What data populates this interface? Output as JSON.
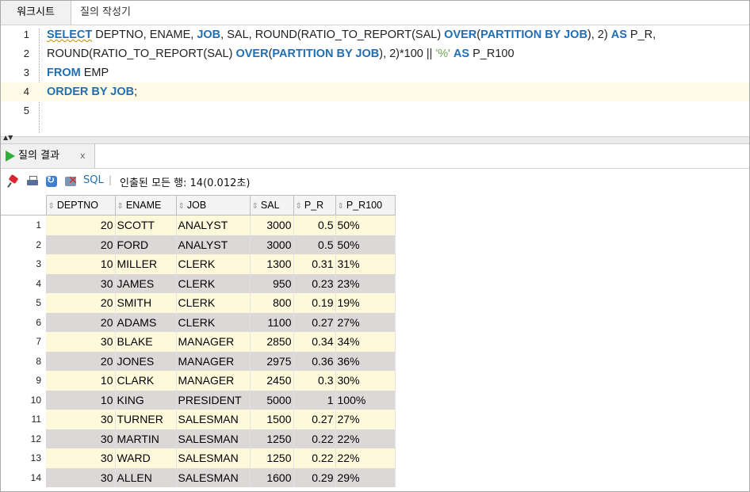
{
  "worksheet_tabs": {
    "active": "워크시트",
    "other": "질의 작성기"
  },
  "editor": {
    "lines": [
      {
        "num": "1"
      },
      {
        "num": "2"
      },
      {
        "num": "3"
      },
      {
        "num": "4"
      },
      {
        "num": "5"
      }
    ],
    "l1": {
      "a": "SELECT",
      "b": " DEPTNO, ENAME, ",
      "c": "JOB",
      "d": ", SAL, ROUND(RATIO_TO_REPORT(SAL) ",
      "e": "OVER",
      "f": "(",
      "g": "PARTITION BY JOB",
      "h": "), 2) ",
      "i": "AS",
      "j": " P_R,"
    },
    "l2": {
      "a": "ROUND(RATIO_TO_REPORT(SAL) ",
      "b": "OVER",
      "c": "(",
      "d": "PARTITION BY JOB",
      "e": "), 2)*100 || ",
      "f": "'%'",
      "g": " ",
      "h": "AS",
      "i": " P_R100"
    },
    "l3": {
      "a": "FROM",
      "b": " EMP"
    },
    "l4": {
      "a": "ORDER BY JOB",
      "b": ";"
    }
  },
  "results": {
    "tab_label": "질의 결과",
    "tab_close": "x",
    "toolbar": {
      "sql_label": "SQL",
      "separator": "|",
      "fetch_status": "인출된 모든 행: 14(0.012초)"
    },
    "columns": [
      "DEPTNO",
      "ENAME",
      "JOB",
      "SAL",
      "P_R",
      "P_R100"
    ],
    "rows": [
      [
        "1",
        "20",
        "SCOTT",
        "ANALYST",
        "3000",
        "0.5",
        "50%"
      ],
      [
        "2",
        "20",
        "FORD",
        "ANALYST",
        "3000",
        "0.5",
        "50%"
      ],
      [
        "3",
        "10",
        "MILLER",
        "CLERK",
        "1300",
        "0.31",
        "31%"
      ],
      [
        "4",
        "30",
        "JAMES",
        "CLERK",
        "950",
        "0.23",
        "23%"
      ],
      [
        "5",
        "20",
        "SMITH",
        "CLERK",
        "800",
        "0.19",
        "19%"
      ],
      [
        "6",
        "20",
        "ADAMS",
        "CLERK",
        "1100",
        "0.27",
        "27%"
      ],
      [
        "7",
        "30",
        "BLAKE",
        "MANAGER",
        "2850",
        "0.34",
        "34%"
      ],
      [
        "8",
        "20",
        "JONES",
        "MANAGER",
        "2975",
        "0.36",
        "36%"
      ],
      [
        "9",
        "10",
        "CLARK",
        "MANAGER",
        "2450",
        "0.3",
        "30%"
      ],
      [
        "10",
        "10",
        "KING",
        "PRESIDENT",
        "5000",
        "1",
        "100%"
      ],
      [
        "11",
        "30",
        "TURNER",
        "SALESMAN",
        "1500",
        "0.27",
        "27%"
      ],
      [
        "12",
        "30",
        "MARTIN",
        "SALESMAN",
        "1250",
        "0.22",
        "22%"
      ],
      [
        "13",
        "30",
        "WARD",
        "SALESMAN",
        "1250",
        "0.22",
        "22%"
      ],
      [
        "14",
        "30",
        "ALLEN",
        "SALESMAN",
        "1600",
        "0.29",
        "29%"
      ]
    ]
  }
}
